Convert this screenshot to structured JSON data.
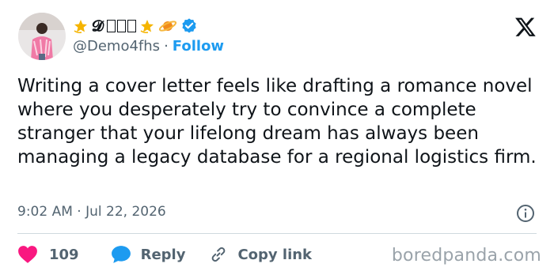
{
  "user": {
    "display_name": "𝓓",
    "handle": "@Demo4fhs",
    "separator": "·",
    "follow_label": "Follow",
    "verified": true
  },
  "tweet": {
    "text": "Writing a cover letter feels like drafting a romance novel where you desperately try to convince a complete stranger that your lifelong dream has always been managing a legacy database for a regional logistics firm.",
    "timestamp": "9:02 AM · Jul 22, 2026"
  },
  "actions": {
    "like_count": "109",
    "reply_label": "Reply",
    "copy_link_label": "Copy link"
  },
  "watermark": "boredpanda.com",
  "colors": {
    "accent": "#1d9bf0",
    "like": "#f91880",
    "text": "#0f1419",
    "secondary": "#536471"
  },
  "icons": [
    "x-logo-icon",
    "verified-badge-icon",
    "info-icon",
    "heart-icon",
    "reply-bubble-icon",
    "link-icon",
    "star-emoji-icon",
    "planet-emoji-icon"
  ]
}
